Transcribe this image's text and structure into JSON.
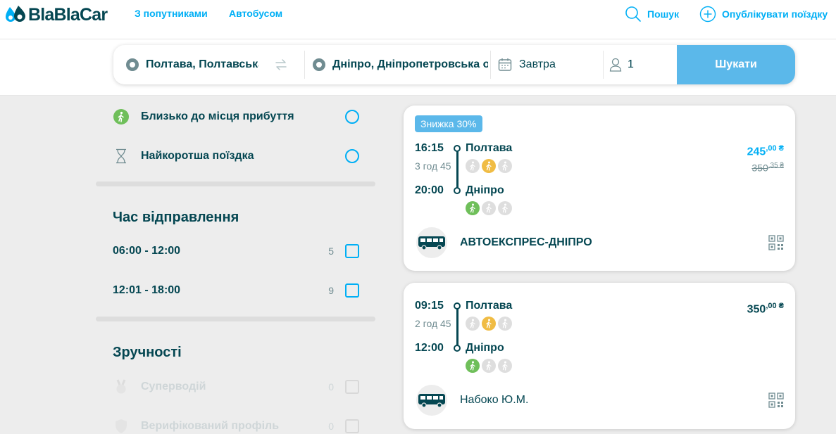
{
  "nav": {
    "logo_text": "BlaBlaCar",
    "link_carpool": "З попутниками",
    "link_bus": "Автобусом",
    "search_label": "Пошук",
    "publish_label": "Опублікувати поїздку"
  },
  "search": {
    "from": "Полтава, Полтавська",
    "to": "Дніпро, Дніпропетровська область",
    "date": "Завтра",
    "passengers": "1",
    "button": "Шукати"
  },
  "filters": {
    "sort_options": [
      {
        "label": "Близько до місця прибуття",
        "icon": "walking-icon"
      },
      {
        "label": "Найкоротша поїздка",
        "icon": "hourglass-icon"
      }
    ],
    "departure_title": "Час відправлення",
    "departure_options": [
      {
        "label": "06:00 - 12:00",
        "count": "5"
      },
      {
        "label": "12:01 - 18:00",
        "count": "9"
      }
    ],
    "amenities_title": "Зручності",
    "amenity_options": [
      {
        "label": "Супер­водій",
        "count": "0"
      },
      {
        "label": "Верифікований профіль",
        "count": "0"
      }
    ]
  },
  "trips": [
    {
      "badge": "Знижка 30%",
      "dep_time": "16:15",
      "duration": "3 год 45",
      "arr_time": "20:00",
      "from_city": "Полтава",
      "to_city": "Дніпро",
      "price_main": "245",
      "price_cents": ",00 ₴",
      "old_price_main": "350",
      "old_price_cents": ",35 ₴",
      "carrier": "АВТОЕКСПРЕС-ДНІПРО"
    },
    {
      "badge": "",
      "dep_time": "09:15",
      "duration": "2 год 45",
      "arr_time": "12:00",
      "from_city": "Полтава",
      "to_city": "Дніпро",
      "price_main": "350",
      "price_cents": ",00 ₴",
      "old_price_main": "",
      "old_price_cents": "",
      "carrier": "Набоко Ю.М."
    }
  ],
  "colors": {
    "accent": "#00aff5",
    "brand_dark": "#054752",
    "search_button": "#5bb8ea",
    "proximity_green": "#6fbf5a",
    "proximity_yellow": "#f0bc44"
  }
}
